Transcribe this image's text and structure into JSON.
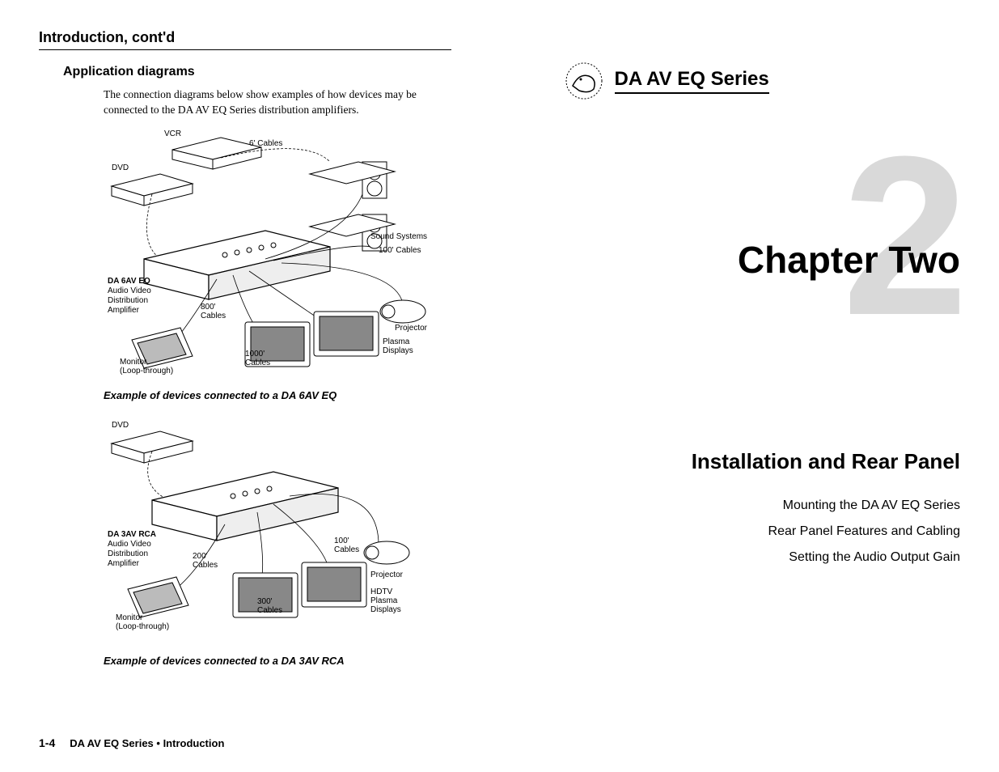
{
  "left_page": {
    "running_head": "Introduction, cont'd",
    "subhead": "Application diagrams",
    "body": "The connection diagrams below show examples of how devices may be connected to the DA AV EQ Series distribution amplifiers.",
    "diagram1": {
      "labels": {
        "vcr": "VCR",
        "six_cables": "6' Cables",
        "dvd": "DVD",
        "sound_systems": "Sound Systems",
        "hundred_cables": "100' Cables",
        "product_bold": "DA 6AV EQ",
        "product_l1": "Audio Video",
        "product_l2": "Distribution",
        "product_l3": "Amplifier",
        "eight_hundred": "800'",
        "eight_hundred2": "Cables",
        "projector": "Projector",
        "plasma1": "Plasma",
        "plasma2": "Displays",
        "monitor1": "Monitor",
        "monitor2": "(Loop-through)",
        "thousand1": "1000'",
        "thousand2": "Cables"
      },
      "caption": "Example of devices connected to a DA 6AV EQ"
    },
    "diagram2": {
      "labels": {
        "dvd": "DVD",
        "product_bold": "DA 3AV RCA",
        "product_l1": "Audio Video",
        "product_l2": "Distribution",
        "product_l3": "Amplifier",
        "two_hundred1": "200'",
        "two_hundred2": "Cables",
        "hundred1": "100'",
        "hundred2": "Cables",
        "projector": "Projector",
        "three_hundred1": "300'",
        "three_hundred2": "Cables",
        "hdtv": "HDTV",
        "plasma1": "Plasma",
        "plasma2": "Displays",
        "monitor1": "Monitor",
        "monitor2": "(Loop-through)"
      },
      "caption": "Example of devices connected to a DA 3AV RCA"
    },
    "footer": {
      "page_num": "1-4",
      "title": "DA AV EQ Series • Introduction"
    }
  },
  "right_page": {
    "series_title": "DA AV EQ Series",
    "big_number": "2",
    "chapter_title": "Chapter Two",
    "section_title": "Installation and Rear Panel",
    "toc": [
      "Mounting the DA AV EQ Series",
      "Rear Panel Features and Cabling",
      "Setting the Audio Output Gain"
    ]
  }
}
